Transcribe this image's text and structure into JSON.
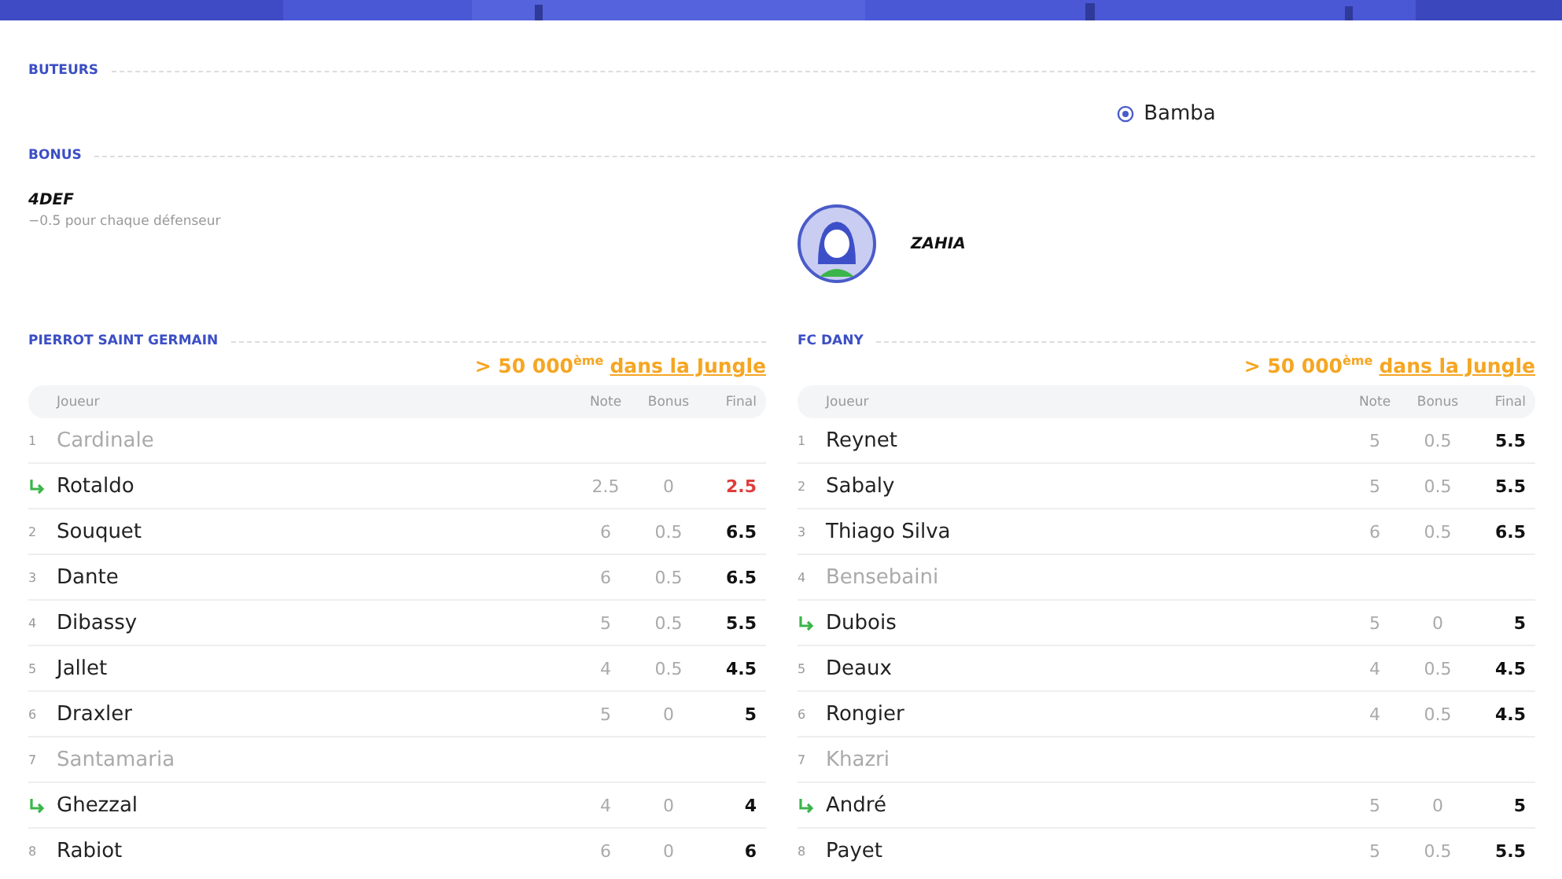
{
  "sections": {
    "scorers_title": "BUTEURS",
    "scorers": [
      "Bamba"
    ],
    "bonus_title": "BONUS"
  },
  "bonus": {
    "home": {
      "code": "4DEF",
      "description": "−0.5 pour chaque défenseur"
    },
    "away": {
      "name": "ZAHIA"
    }
  },
  "teams": [
    {
      "name": "PIERROT SAINT GERMAIN",
      "rank": "> 50 000$^{ème}$",
      "rank_link": "dans la Jungle",
      "columns": [
        "Joueur",
        "Note",
        "Bonus",
        "Final"
      ],
      "rows": [
        {
          "kind": "out",
          "number": "1",
          "name": "Cardinale"
        },
        {
          "kind": "sub",
          "name": "Rotaldo",
          "note": "2.5",
          "bonus": "0",
          "final": "2.5",
          "low": true
        },
        {
          "kind": "starter",
          "number": "2",
          "name": "Souquet",
          "note": "6",
          "bonus": "0.5",
          "final": "6.5",
          "low": false
        },
        {
          "kind": "starter",
          "number": "3",
          "name": "Dante",
          "note": "6",
          "bonus": "0.5",
          "final": "6.5",
          "low": false
        },
        {
          "kind": "starter",
          "number": "4",
          "name": "Dibassy",
          "note": "5",
          "bonus": "0.5",
          "final": "5.5",
          "low": false
        },
        {
          "kind": "starter",
          "number": "5",
          "name": "Jallet",
          "note": "4",
          "bonus": "0.5",
          "final": "4.5",
          "low": false
        },
        {
          "kind": "starter",
          "number": "6",
          "name": "Draxler",
          "note": "5",
          "bonus": "0",
          "final": "5",
          "low": false
        },
        {
          "kind": "out",
          "number": "7",
          "name": "Santamaria"
        },
        {
          "kind": "sub",
          "name": "Ghezzal",
          "note": "4",
          "bonus": "0",
          "final": "4",
          "low": false
        },
        {
          "kind": "starter",
          "number": "8",
          "name": "Rabiot",
          "note": "6",
          "bonus": "0",
          "final": "6",
          "low": false
        }
      ]
    },
    {
      "name": "FC DANY",
      "rank": "> 50 000$^{ème}$",
      "rank_link": "dans la Jungle",
      "columns": [
        "Joueur",
        "Note",
        "Bonus",
        "Final"
      ],
      "rows": [
        {
          "kind": "starter",
          "number": "1",
          "name": "Reynet",
          "note": "5",
          "bonus": "0.5",
          "final": "5.5",
          "low": false
        },
        {
          "kind": "starter",
          "number": "2",
          "name": "Sabaly",
          "note": "5",
          "bonus": "0.5",
          "final": "5.5",
          "low": false
        },
        {
          "kind": "starter",
          "number": "3",
          "name": "Thiago Silva",
          "note": "6",
          "bonus": "0.5",
          "final": "6.5",
          "low": false
        },
        {
          "kind": "out",
          "number": "4",
          "name": "Bensebaini"
        },
        {
          "kind": "sub",
          "name": "Dubois",
          "note": "5",
          "bonus": "0",
          "final": "5",
          "low": false
        },
        {
          "kind": "starter",
          "number": "5",
          "name": "Deaux",
          "note": "4",
          "bonus": "0.5",
          "final": "4.5",
          "low": false
        },
        {
          "kind": "starter",
          "number": "6",
          "name": "Rongier",
          "note": "4",
          "bonus": "0.5",
          "final": "4.5",
          "low": false
        },
        {
          "kind": "out",
          "number": "7",
          "name": "Khazri"
        },
        {
          "kind": "sub",
          "name": "André",
          "note": "5",
          "bonus": "0",
          "final": "5",
          "low": false
        },
        {
          "kind": "starter",
          "number": "8",
          "name": "Payet",
          "note": "5",
          "bonus": "0.5",
          "final": "5.5",
          "low": false
        }
      ]
    }
  ]
}
